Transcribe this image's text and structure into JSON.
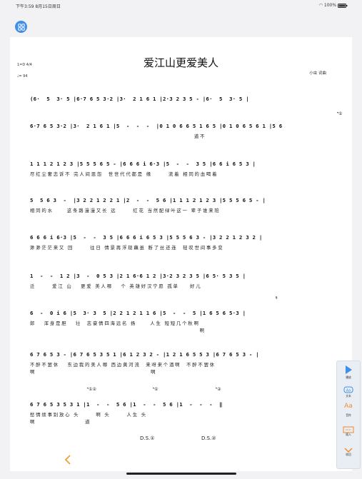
{
  "status_bar": {
    "time": "下午3:59 8月15日周日",
    "battery": "100%"
  },
  "song": {
    "title": "爱江山更爱美人",
    "key": "1=D 4/4",
    "tempo": "♩= 94",
    "composer": "小虫 词曲"
  },
  "score": [
    {
      "notes": "(6·  5  3· 5 |6·7 6 5 3·2 |3·  2 1 6 1 |2·3 2 3 5 - |6·  5  3· 5 |",
      "lyrics": ""
    },
    {
      "notes": "6·7 6 5 3·2 |3·  2 1 6 1 |5  -  -  -  |0 1 0 6 6 5 1 6 5 |0 1 0 6 5 6 1 |5 6",
      "lyrics": "                                                            道不"
    },
    {
      "notes": "1 1 1 2 1 2 3 |5 5 5 6 5 - |6 6 6 i 6·3 |5  -  -  3 5 |6 6 i 6 5 3 |",
      "lyrics": "尽红尘奢恋诉不 完人间恩怨  世世代代都是 缘      流着 相同的血喝着"
    },
    {
      "notes": "5  5 6 3  -  |3 2 2 1 2 2 1 |2  -  -  5 6 |1 1 1 2 1 2 3 |5 5 5 6 5 - |",
      "lyrics": "相同的水     这条路漫漫又长 远      红花 当然配绿叶这一 辈子谁来陪"
    },
    {
      "notes": "6 6 6 i 6·3 |5  -  -  3 5 |6 6 6 i 6 5 3 |5 5 5 6 3 - |3 2 2 1 2 3 2 |",
      "lyrics": "渺渺茫茫来又 回      往日 情景再浮现藕虽 断了丝还连  轻叹世间事多变"
    },
    {
      "notes": "1  -  -  1 2 |3  -  0 5 3 |2 1 6·6 1 2 |3·2 3 2 3 5 |6 5· 5 3 5 |",
      "lyrics": "迁      爱江 山   更爱 美人哪   个 英雄好汉宁愿 孤单    好儿"
    },
    {
      "notes": "6  -  0 i 6 |5  3· 3  5 |2 2 1 2 1 1 6 |5  -  -  5 |1 6 5 6 5·3 |",
      "lyrics": "郎   浑身是胆   壮  志豪情四海远名 扬     人生 短短几个秋啊"
    },
    {
      "notes": "6 7 6 5 3 - |6 7 6 5 3 5 1 |6 1 2 3 2 - |1 2 1 6 5 5 3 |6 7 6 5 3 - |",
      "lyrics": "不醉不罢休   东边我的美人哪 西边黄河流  来呀来个酒啊  不醉不罢休"
    },
    {
      "notes": "6 7 6 5 3 5 3 1 |1  -  -  5 6 |1  -  -  5 6 |1  -  -  -  ‖",
      "lyrics": "愁情烦事别放心 头      啊 头      人生 头"
    }
  ],
  "score_second_lyrics": [
    {
      "row": 6,
      "text": "                                                              啊"
    },
    {
      "row": 7,
      "text": "啊                                          啊"
    },
    {
      "row": 8,
      "text": "啊                  道"
    }
  ],
  "marks": {
    "coda1": "𝄌①",
    "segno": "𝄋",
    "coda12": "𝄌①②",
    "coda2": "𝄌②",
    "ds1": "D.S.①",
    "ds2": "D.S.②"
  },
  "toolbar": {
    "items": [
      {
        "label": "播放",
        "icon": "play-icon"
      },
      {
        "label": "文本",
        "icon": "text-bubble-icon"
      },
      {
        "label": "音符",
        "icon": "font-aa-icon"
      },
      {
        "label": "插入",
        "icon": "insert-box-icon"
      },
      {
        "label": "收回",
        "icon": "chevron-down-icon"
      }
    ]
  },
  "colors": {
    "accent": "#3f8ee8",
    "toolbar_accent": "#f08a2a"
  }
}
